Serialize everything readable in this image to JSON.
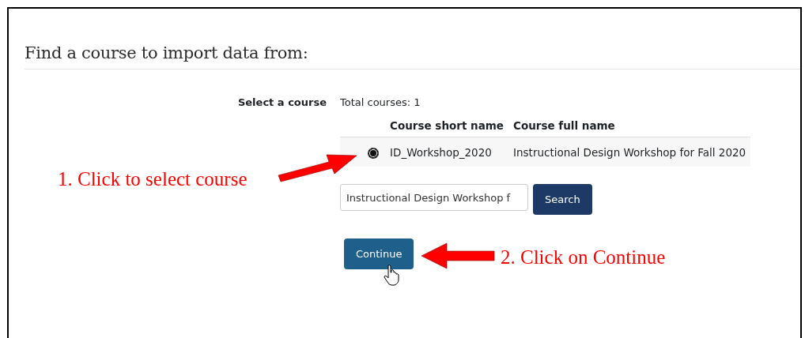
{
  "heading": "Find a course to import data from:",
  "form": {
    "label": "Select a course",
    "total": "Total courses: 1",
    "columns": [
      "Course short name",
      "Course full name"
    ],
    "rows": [
      {
        "short_name": "ID_Workshop_2020",
        "full_name": "Instructional Design Workshop for Fall 2020",
        "selected": true
      }
    ],
    "search": {
      "value": "Instructional Design Workshop f",
      "button": "Search"
    },
    "continue": "Continue"
  },
  "annotations": [
    "1. Click to select course",
    "2. Click on Continue"
  ]
}
